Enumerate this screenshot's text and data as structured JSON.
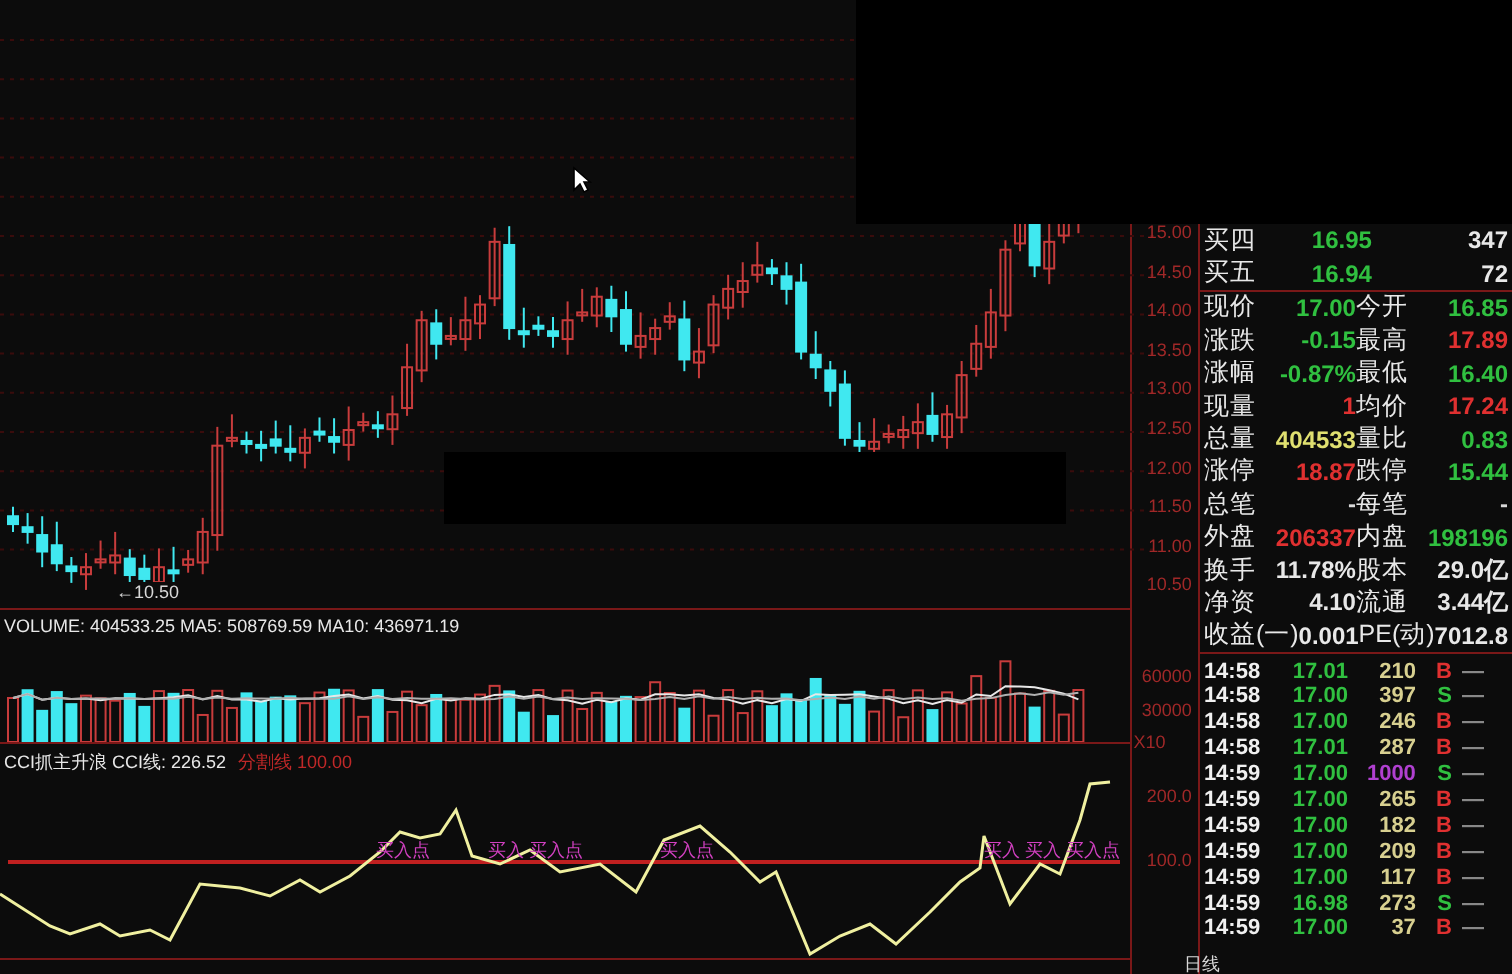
{
  "price_chart": {
    "axis_labels": [
      "15.00",
      "14.50",
      "14.00",
      "13.50",
      "13.00",
      "12.50",
      "12.00",
      "11.50",
      "11.00",
      "10.50"
    ],
    "low_marker": "←10.50"
  },
  "volume_pane": {
    "legend": "VOLUME: 404533.25  MA5: 508769.59  MA10: 436971.19",
    "axis_labels": [
      "60000",
      "30000"
    ],
    "unit": "X10"
  },
  "cci_pane": {
    "legend": "CCI抓主升浪  CCI线: 226.52",
    "divider_legend": "分割线 100.00",
    "axis_labels": [
      "200.0",
      "100.0"
    ],
    "signals": [
      {
        "text": "买入点"
      },
      {
        "text": "买入 买入点"
      },
      {
        "text": "买入点"
      },
      {
        "text": "买入 买入 买入点"
      }
    ]
  },
  "bottom_axis": {
    "label": "日线"
  },
  "order_book": [
    {
      "label": "买四",
      "price": "16.95",
      "volume": "347"
    },
    {
      "label": "买五",
      "price": "16.94",
      "volume": "72"
    }
  ],
  "quote": [
    [
      {
        "label": "现价",
        "value": "17.00",
        "color": "#30c040"
      },
      {
        "label": "今开",
        "value": "16.85",
        "color": "#30c040"
      }
    ],
    [
      {
        "label": "涨跌",
        "value": "-0.15",
        "color": "#30c040"
      },
      {
        "label": "最高",
        "value": "17.89",
        "color": "#e03030"
      }
    ],
    [
      {
        "label": "涨幅",
        "value": "-0.87%",
        "color": "#30c040"
      },
      {
        "label": "最低",
        "value": "16.40",
        "color": "#30c040"
      }
    ],
    [
      {
        "label": "现量",
        "value": "1",
        "color": "#e03030"
      },
      {
        "label": "均价",
        "value": "17.24",
        "color": "#e03030"
      }
    ],
    [
      {
        "label": "总量",
        "value": "404533",
        "color": "#e0e070"
      },
      {
        "label": "量比",
        "value": "0.83",
        "color": "#30c040"
      }
    ],
    [
      {
        "label": "涨停",
        "value": "18.87",
        "color": "#e03030"
      },
      {
        "label": "跌停",
        "value": "15.44",
        "color": "#30c040"
      }
    ],
    [
      {
        "label": "总笔",
        "value": "-",
        "color": "#d8d8d8"
      },
      {
        "label": "每笔",
        "value": "-",
        "color": "#d8d8d8"
      }
    ],
    [
      {
        "label": "外盘",
        "value": "206337",
        "color": "#e03030"
      },
      {
        "label": "内盘",
        "value": "198196",
        "color": "#30c040"
      }
    ],
    [
      {
        "label": "换手",
        "value": "11.78%",
        "color": "#e8e8e8"
      },
      {
        "label": "股本",
        "value": "29.0亿",
        "color": "#e8e8e8"
      }
    ],
    [
      {
        "label": "净资",
        "value": "4.10",
        "color": "#e8e8e8"
      },
      {
        "label": "流通",
        "value": "3.44亿",
        "color": "#e8e8e8"
      }
    ],
    [
      {
        "label": "收益(一)",
        "value": "0.001",
        "color": "#e8e8e8"
      },
      {
        "label": "PE(动)",
        "value": "7012.8",
        "color": "#e8e8e8"
      }
    ]
  ],
  "trades": [
    {
      "time": "14:58",
      "price": "17.01",
      "volume": {
        "text": "210",
        "color": "#d8d090"
      },
      "side": {
        "text": "B",
        "color": "#e03030"
      },
      "flag": "—"
    },
    {
      "time": "14:58",
      "price": "17.00",
      "volume": {
        "text": "397",
        "color": "#d8d090"
      },
      "side": {
        "text": "S",
        "color": "#30c040"
      },
      "flag": "—"
    },
    {
      "time": "14:58",
      "price": "17.00",
      "volume": {
        "text": "246",
        "color": "#d8d090"
      },
      "side": {
        "text": "B",
        "color": "#e03030"
      },
      "flag": "—"
    },
    {
      "time": "14:58",
      "price": "17.01",
      "volume": {
        "text": "287",
        "color": "#d8d090"
      },
      "side": {
        "text": "B",
        "color": "#e03030"
      },
      "flag": "—"
    },
    {
      "time": "14:59",
      "price": "17.00",
      "volume": {
        "text": "1000",
        "color": "#b040d0"
      },
      "side": {
        "text": "S",
        "color": "#30c040"
      },
      "flag": "—"
    },
    {
      "time": "14:59",
      "price": "17.00",
      "volume": {
        "text": "265",
        "color": "#d8d090"
      },
      "side": {
        "text": "B",
        "color": "#e03030"
      },
      "flag": "—"
    },
    {
      "time": "14:59",
      "price": "17.00",
      "volume": {
        "text": "182",
        "color": "#d8d090"
      },
      "side": {
        "text": "B",
        "color": "#e03030"
      },
      "flag": "—"
    },
    {
      "time": "14:59",
      "price": "17.00",
      "volume": {
        "text": "209",
        "color": "#d8d090"
      },
      "side": {
        "text": "B",
        "color": "#e03030"
      },
      "flag": "—"
    },
    {
      "time": "14:59",
      "price": "17.00",
      "volume": {
        "text": "117",
        "color": "#d8d090"
      },
      "side": {
        "text": "B",
        "color": "#e03030"
      },
      "flag": "—"
    },
    {
      "time": "14:59",
      "price": "16.98",
      "volume": {
        "text": "273",
        "color": "#d8d090"
      },
      "side": {
        "text": "S",
        "color": "#30c040"
      },
      "flag": "—"
    },
    {
      "time": "14:59",
      "price": "17.00",
      "volume": {
        "text": "37",
        "color": "#d8d090"
      },
      "side": {
        "text": "B",
        "color": "#e03030"
      },
      "flag": "—"
    }
  ]
}
